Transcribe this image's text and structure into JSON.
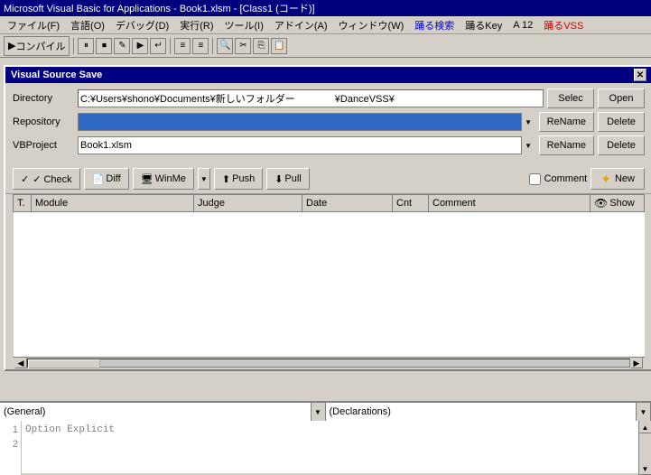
{
  "titlebar": {
    "text": "Microsoft Visual Basic for Applications - Book1.xlsm - [Class1 (コード)]"
  },
  "menubar": {
    "items": [
      {
        "label": "ファイル(F)",
        "key": "file"
      },
      {
        "label": "言語(O)",
        "key": "language"
      },
      {
        "label": "デバッグ(D)",
        "key": "debug"
      },
      {
        "label": "実行(R)",
        "key": "run"
      },
      {
        "label": "ツール(I)",
        "key": "tools"
      },
      {
        "label": "アドイン(A)",
        "key": "addins"
      },
      {
        "label": "ウィンドウ(W)",
        "key": "window"
      },
      {
        "label": "踊る検索",
        "key": "search"
      },
      {
        "label": "踊るKey",
        "key": "key"
      },
      {
        "label": "A 12",
        "key": "a12"
      },
      {
        "label": "踊るVSS",
        "key": "vss"
      }
    ]
  },
  "toolbar": {
    "compile_label": "コンパイル"
  },
  "vss_dialog": {
    "title": "Visual Source Save",
    "directory_label": "Directory",
    "directory_value": "C:¥Users¥shono¥Documents¥新しいフォルダー",
    "directory_suffix": "¥DanceVSS¥",
    "repository_label": "Repository",
    "repository_value": "",
    "vbproject_label": "VBProject",
    "vbproject_value": "Book1.xlsm",
    "selec_btn": "Selec",
    "open_btn": "Open",
    "rename_btn1": "ReName",
    "delete_btn1": "Delete",
    "rename_btn2": "ReName",
    "delete_btn2": "Delete",
    "check_btn": "✓ Check",
    "diff_btn": "Diff",
    "winme_btn": "WinMe",
    "push_btn": "Push",
    "pull_btn": "Pull",
    "comment_label": "Comment",
    "new_btn": "New",
    "table": {
      "cols": [
        {
          "label": "T.",
          "key": "type"
        },
        {
          "label": "Module",
          "key": "module"
        },
        {
          "label": "Judge",
          "key": "judge"
        },
        {
          "label": "Date",
          "key": "date"
        },
        {
          "label": "Cnt",
          "key": "cnt"
        },
        {
          "label": "Comment",
          "key": "comment"
        }
      ],
      "show_label": "Show",
      "rows": []
    }
  },
  "code_area": {
    "general_label": "(General)",
    "declarations_label": "(Declarations)",
    "code_text": "Option Explicit",
    "lines": [
      "1",
      "2"
    ]
  }
}
